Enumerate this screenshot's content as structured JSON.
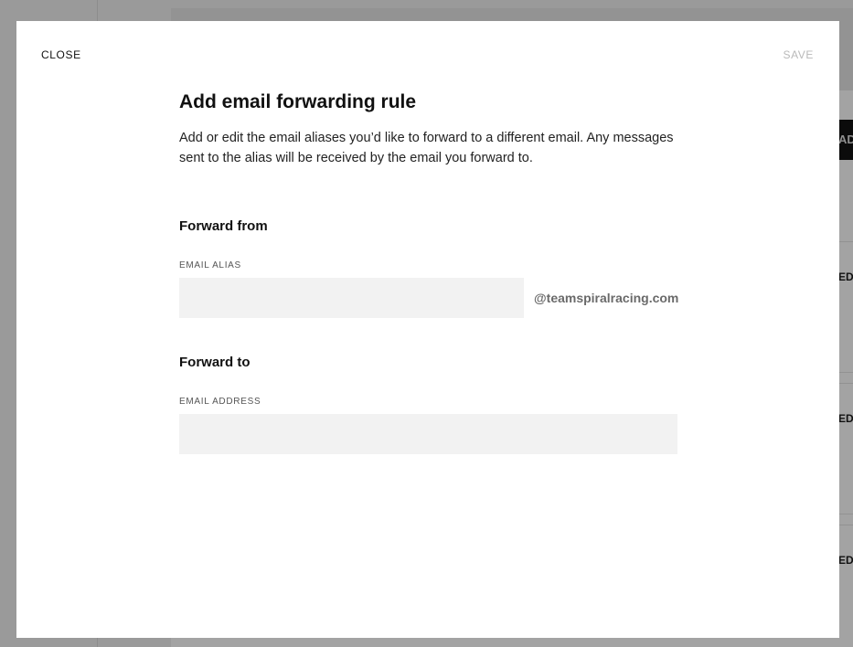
{
  "background": {
    "add_button_label": "ADD",
    "edit_link_label": "EDIT"
  },
  "modal": {
    "close_label": "CLOSE",
    "save_label": "SAVE",
    "title": "Add email forwarding rule",
    "description": "Add or edit the email aliases you’d like to forward to a different email. Any messages sent to the alias will be received by the email you forward to.",
    "forward_from": {
      "heading": "Forward from",
      "alias_label": "EMAIL ALIAS",
      "alias_value": "",
      "domain_suffix": "@teamspiralracing.com"
    },
    "forward_to": {
      "heading": "Forward to",
      "address_label": "EMAIL ADDRESS",
      "address_value": ""
    }
  }
}
